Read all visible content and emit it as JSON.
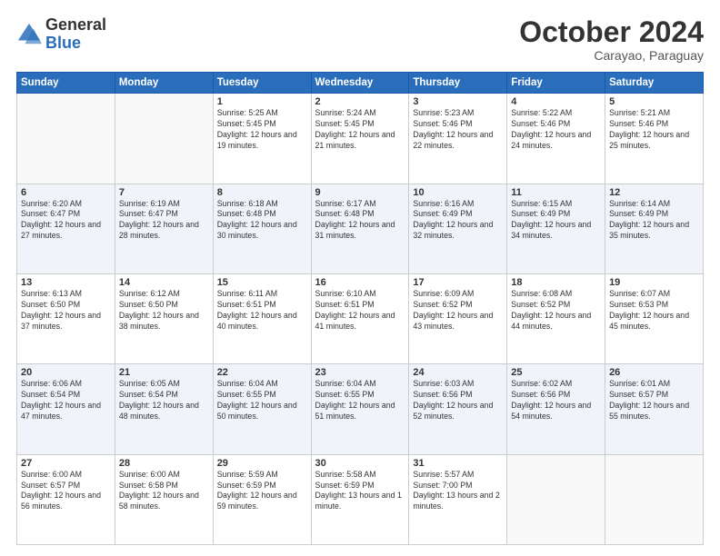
{
  "header": {
    "logo_general": "General",
    "logo_blue": "Blue",
    "month_title": "October 2024",
    "subtitle": "Carayao, Paraguay"
  },
  "weekdays": [
    "Sunday",
    "Monday",
    "Tuesday",
    "Wednesday",
    "Thursday",
    "Friday",
    "Saturday"
  ],
  "weeks": [
    [
      {
        "day": "",
        "info": ""
      },
      {
        "day": "",
        "info": ""
      },
      {
        "day": "1",
        "info": "Sunrise: 5:25 AM\nSunset: 5:45 PM\nDaylight: 12 hours and 19 minutes."
      },
      {
        "day": "2",
        "info": "Sunrise: 5:24 AM\nSunset: 5:45 PM\nDaylight: 12 hours and 21 minutes."
      },
      {
        "day": "3",
        "info": "Sunrise: 5:23 AM\nSunset: 5:46 PM\nDaylight: 12 hours and 22 minutes."
      },
      {
        "day": "4",
        "info": "Sunrise: 5:22 AM\nSunset: 5:46 PM\nDaylight: 12 hours and 24 minutes."
      },
      {
        "day": "5",
        "info": "Sunrise: 5:21 AM\nSunset: 5:46 PM\nDaylight: 12 hours and 25 minutes."
      }
    ],
    [
      {
        "day": "6",
        "info": "Sunrise: 6:20 AM\nSunset: 6:47 PM\nDaylight: 12 hours and 27 minutes."
      },
      {
        "day": "7",
        "info": "Sunrise: 6:19 AM\nSunset: 6:47 PM\nDaylight: 12 hours and 28 minutes."
      },
      {
        "day": "8",
        "info": "Sunrise: 6:18 AM\nSunset: 6:48 PM\nDaylight: 12 hours and 30 minutes."
      },
      {
        "day": "9",
        "info": "Sunrise: 6:17 AM\nSunset: 6:48 PM\nDaylight: 12 hours and 31 minutes."
      },
      {
        "day": "10",
        "info": "Sunrise: 6:16 AM\nSunset: 6:49 PM\nDaylight: 12 hours and 32 minutes."
      },
      {
        "day": "11",
        "info": "Sunrise: 6:15 AM\nSunset: 6:49 PM\nDaylight: 12 hours and 34 minutes."
      },
      {
        "day": "12",
        "info": "Sunrise: 6:14 AM\nSunset: 6:49 PM\nDaylight: 12 hours and 35 minutes."
      }
    ],
    [
      {
        "day": "13",
        "info": "Sunrise: 6:13 AM\nSunset: 6:50 PM\nDaylight: 12 hours and 37 minutes."
      },
      {
        "day": "14",
        "info": "Sunrise: 6:12 AM\nSunset: 6:50 PM\nDaylight: 12 hours and 38 minutes."
      },
      {
        "day": "15",
        "info": "Sunrise: 6:11 AM\nSunset: 6:51 PM\nDaylight: 12 hours and 40 minutes."
      },
      {
        "day": "16",
        "info": "Sunrise: 6:10 AM\nSunset: 6:51 PM\nDaylight: 12 hours and 41 minutes."
      },
      {
        "day": "17",
        "info": "Sunrise: 6:09 AM\nSunset: 6:52 PM\nDaylight: 12 hours and 43 minutes."
      },
      {
        "day": "18",
        "info": "Sunrise: 6:08 AM\nSunset: 6:52 PM\nDaylight: 12 hours and 44 minutes."
      },
      {
        "day": "19",
        "info": "Sunrise: 6:07 AM\nSunset: 6:53 PM\nDaylight: 12 hours and 45 minutes."
      }
    ],
    [
      {
        "day": "20",
        "info": "Sunrise: 6:06 AM\nSunset: 6:54 PM\nDaylight: 12 hours and 47 minutes."
      },
      {
        "day": "21",
        "info": "Sunrise: 6:05 AM\nSunset: 6:54 PM\nDaylight: 12 hours and 48 minutes."
      },
      {
        "day": "22",
        "info": "Sunrise: 6:04 AM\nSunset: 6:55 PM\nDaylight: 12 hours and 50 minutes."
      },
      {
        "day": "23",
        "info": "Sunrise: 6:04 AM\nSunset: 6:55 PM\nDaylight: 12 hours and 51 minutes."
      },
      {
        "day": "24",
        "info": "Sunrise: 6:03 AM\nSunset: 6:56 PM\nDaylight: 12 hours and 52 minutes."
      },
      {
        "day": "25",
        "info": "Sunrise: 6:02 AM\nSunset: 6:56 PM\nDaylight: 12 hours and 54 minutes."
      },
      {
        "day": "26",
        "info": "Sunrise: 6:01 AM\nSunset: 6:57 PM\nDaylight: 12 hours and 55 minutes."
      }
    ],
    [
      {
        "day": "27",
        "info": "Sunrise: 6:00 AM\nSunset: 6:57 PM\nDaylight: 12 hours and 56 minutes."
      },
      {
        "day": "28",
        "info": "Sunrise: 6:00 AM\nSunset: 6:58 PM\nDaylight: 12 hours and 58 minutes."
      },
      {
        "day": "29",
        "info": "Sunrise: 5:59 AM\nSunset: 6:59 PM\nDaylight: 12 hours and 59 minutes."
      },
      {
        "day": "30",
        "info": "Sunrise: 5:58 AM\nSunset: 6:59 PM\nDaylight: 13 hours and 1 minute."
      },
      {
        "day": "31",
        "info": "Sunrise: 5:57 AM\nSunset: 7:00 PM\nDaylight: 13 hours and 2 minutes."
      },
      {
        "day": "",
        "info": ""
      },
      {
        "day": "",
        "info": ""
      }
    ]
  ]
}
